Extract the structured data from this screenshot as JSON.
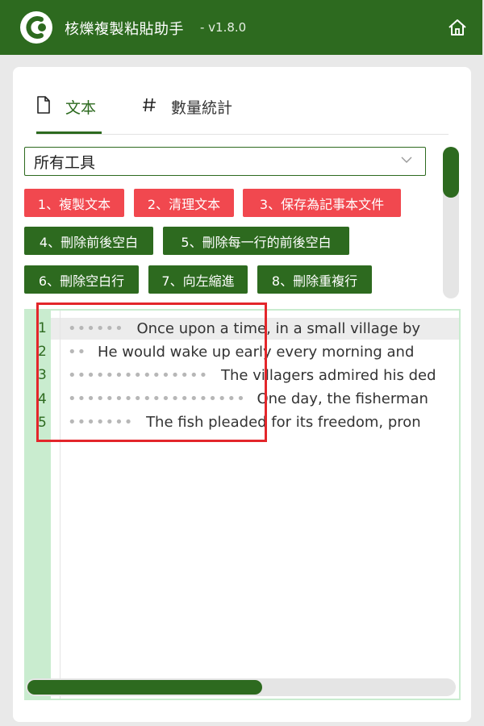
{
  "app": {
    "title": "核爍複製粘貼助手",
    "version": "- v1.8.0"
  },
  "tabs": [
    {
      "label": "文本",
      "icon": "file-icon",
      "active": true
    },
    {
      "label": "數量統計",
      "icon": "hash-icon",
      "active": false
    }
  ],
  "tool_select": {
    "value": "所有工具"
  },
  "buttons": [
    {
      "label": "1、複製文本",
      "color": "#f1484f"
    },
    {
      "label": "2、清理文本",
      "color": "#f1484f"
    },
    {
      "label": "3、保存為記事本文件",
      "color": "#f1484f"
    },
    {
      "label": "4、刪除前後空白",
      "color": "#2d6a1f"
    },
    {
      "label": "5、刪除每一行的前後空白",
      "color": "#2d6a1f"
    },
    {
      "label": "6、刪除空白行",
      "color": "#2d6a1f"
    },
    {
      "label": "7、向左縮進",
      "color": "#2d6a1f"
    },
    {
      "label": "8、刪除重複行",
      "color": "#2d6a1f"
    }
  ],
  "editor": {
    "line_numbers": [
      "1",
      "2",
      "3",
      "4",
      "5"
    ],
    "lines": [
      {
        "lead": "••••••",
        "text": "Once upon a time, in a small village by"
      },
      {
        "lead": "••",
        "text": "He would wake up early every morning and"
      },
      {
        "lead": "•••••••••••••••",
        "text": "The villagers admired his ded"
      },
      {
        "lead": "•••••••••••••••••••",
        "text": "One day, the fisherman"
      },
      {
        "lead": "•••••••",
        "text": "The fish pleaded for its freedom, pron"
      }
    ]
  },
  "colors": {
    "brand_green": "#2d6a1f",
    "danger_red": "#f1484f",
    "highlight_red": "#e3262b",
    "gutter": "#c9eccf"
  }
}
